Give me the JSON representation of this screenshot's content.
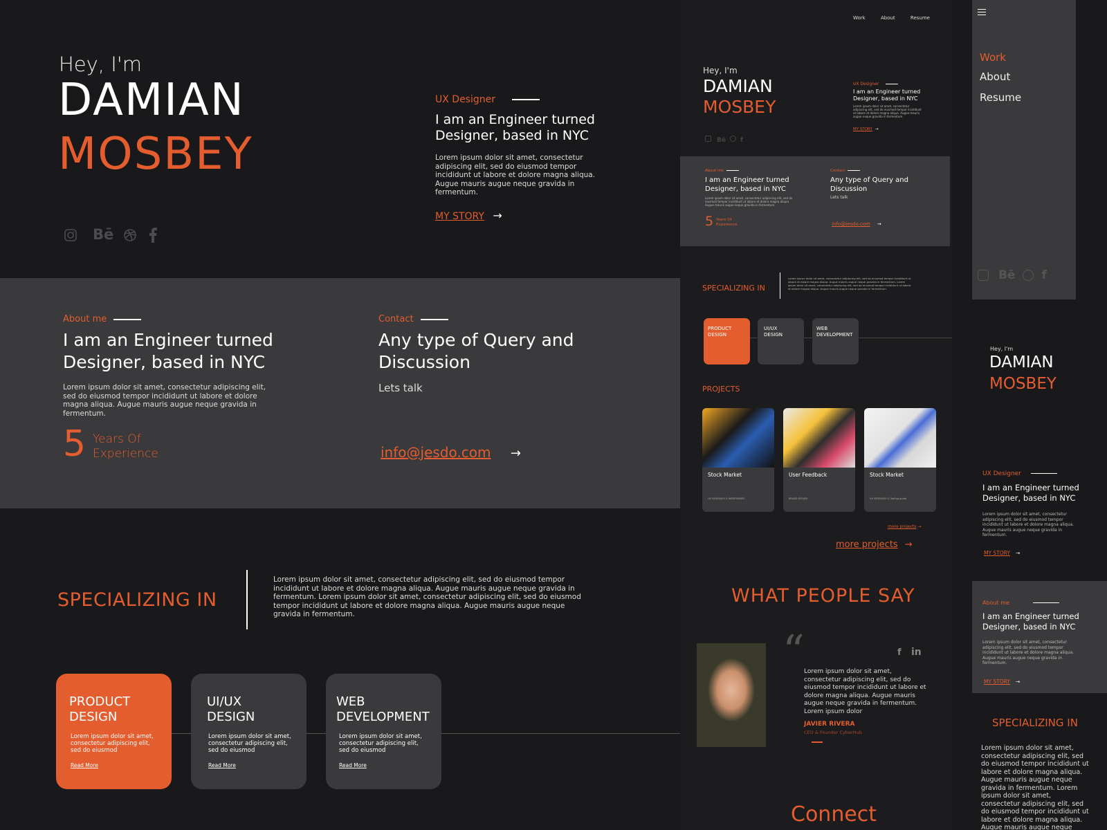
{
  "colors": {
    "accent": "#e35d2f",
    "bg_dark": "#19191b",
    "bg_panel": "#3a3a3c"
  },
  "hero": {
    "greeting": "Hey, I'm",
    "first_name": "DAMIAN",
    "last_name": "MOSBEY",
    "role": "UX Designer",
    "tagline_line1": "I am an Engineer turned",
    "tagline_line2": "Designer, based in NYC",
    "body": "Lorem ipsum dolor sit amet, consectetur adipiscing elit, sed do eiusmod tempor incididunt ut labore et dolore magna aliqua. Augue mauris augue neque gravida in fermentum.",
    "cta": "MY STORY",
    "social_icons": [
      "instagram-icon",
      "behance-icon",
      "dribbble-icon",
      "facebook-icon"
    ],
    "behance_text": "Bē"
  },
  "about": {
    "label": "About me",
    "heading_line1": "I am an Engineer turned",
    "heading_line2": "Designer, based in NYC",
    "body": "Lorem ipsum dolor sit amet, consectetur adipiscing elit, sed do eiusmod tempor incididunt ut labore et dolore magna aliqua. Augue mauris augue neque gravida in fermentum.",
    "years_number": "5",
    "years_line1": "Years Of",
    "years_line2": "Experience"
  },
  "contact": {
    "label": "Contact",
    "heading_line1": "Any type of Query and",
    "heading_line2": "Discussion",
    "subtitle": "Lets talk",
    "email": "info@jesdo.com"
  },
  "specializing": {
    "title": "SPECIALIZING IN",
    "body": "Lorem ipsum dolor sit amet, consectetur adipiscing elit, sed do eiusmod tempor incididunt ut labore et dolore magna aliqua. Augue mauris augue neque gravida in fermentum. Lorem ipsum dolor sit amet, consectetur adipiscing elit, sed do eiusmod tempor incididunt ut labore et dolore magna aliqua. Augue mauris augue neque gravida in fermentum.",
    "cards": [
      {
        "line1": "PRODUCT",
        "line2": "DESIGN",
        "body": "Lorem ipsum dolor sit amet, consectetur adipiscing elit, sed do eiusmod",
        "link": "Read More"
      },
      {
        "line1": "UI/UX",
        "line2": "DESIGN",
        "body": "Lorem ipsum dolor sit amet, consectetur adipiscing elit, sed do eiusmod",
        "link": "Read More"
      },
      {
        "line1": "WEB",
        "line2": "DEVELOPMENT",
        "body": "Lorem ipsum dolor sit amet, consectetur adipiscing elit, sed do eiusmod",
        "link": "Read More"
      }
    ]
  },
  "tablet": {
    "nav": [
      "Work",
      "About",
      "Resume"
    ],
    "projects_title": "PROJECTS",
    "projects": [
      {
        "name": "Stock Market",
        "meta": "UX RESEARCH & WIREFRAMES"
      },
      {
        "name": "User Feedback",
        "meta": "BRAND DESIGN"
      },
      {
        "name": "Stock Market",
        "meta": "UX RESEARCH & Testing guide"
      }
    ],
    "more_small": "more projects",
    "more_large": "more projects",
    "testimonial_title": "WHAT PEOPLE SAY",
    "quote": "Lorem ipsum dolor sit amet, consectetur adipiscing elit, sed do eiusmod tempor incididunt ut labore et dolore magna aliqua. Augue mauris augue neque gravida in fermentum. Lorem ipsum dolor",
    "author": "JAVIER RIVERA",
    "author_title": "CEO & Founder CyberHub",
    "connect": "Connect",
    "linkedin": "in"
  },
  "mobile": {
    "menu": [
      "Work",
      "About",
      "Resume"
    ]
  }
}
